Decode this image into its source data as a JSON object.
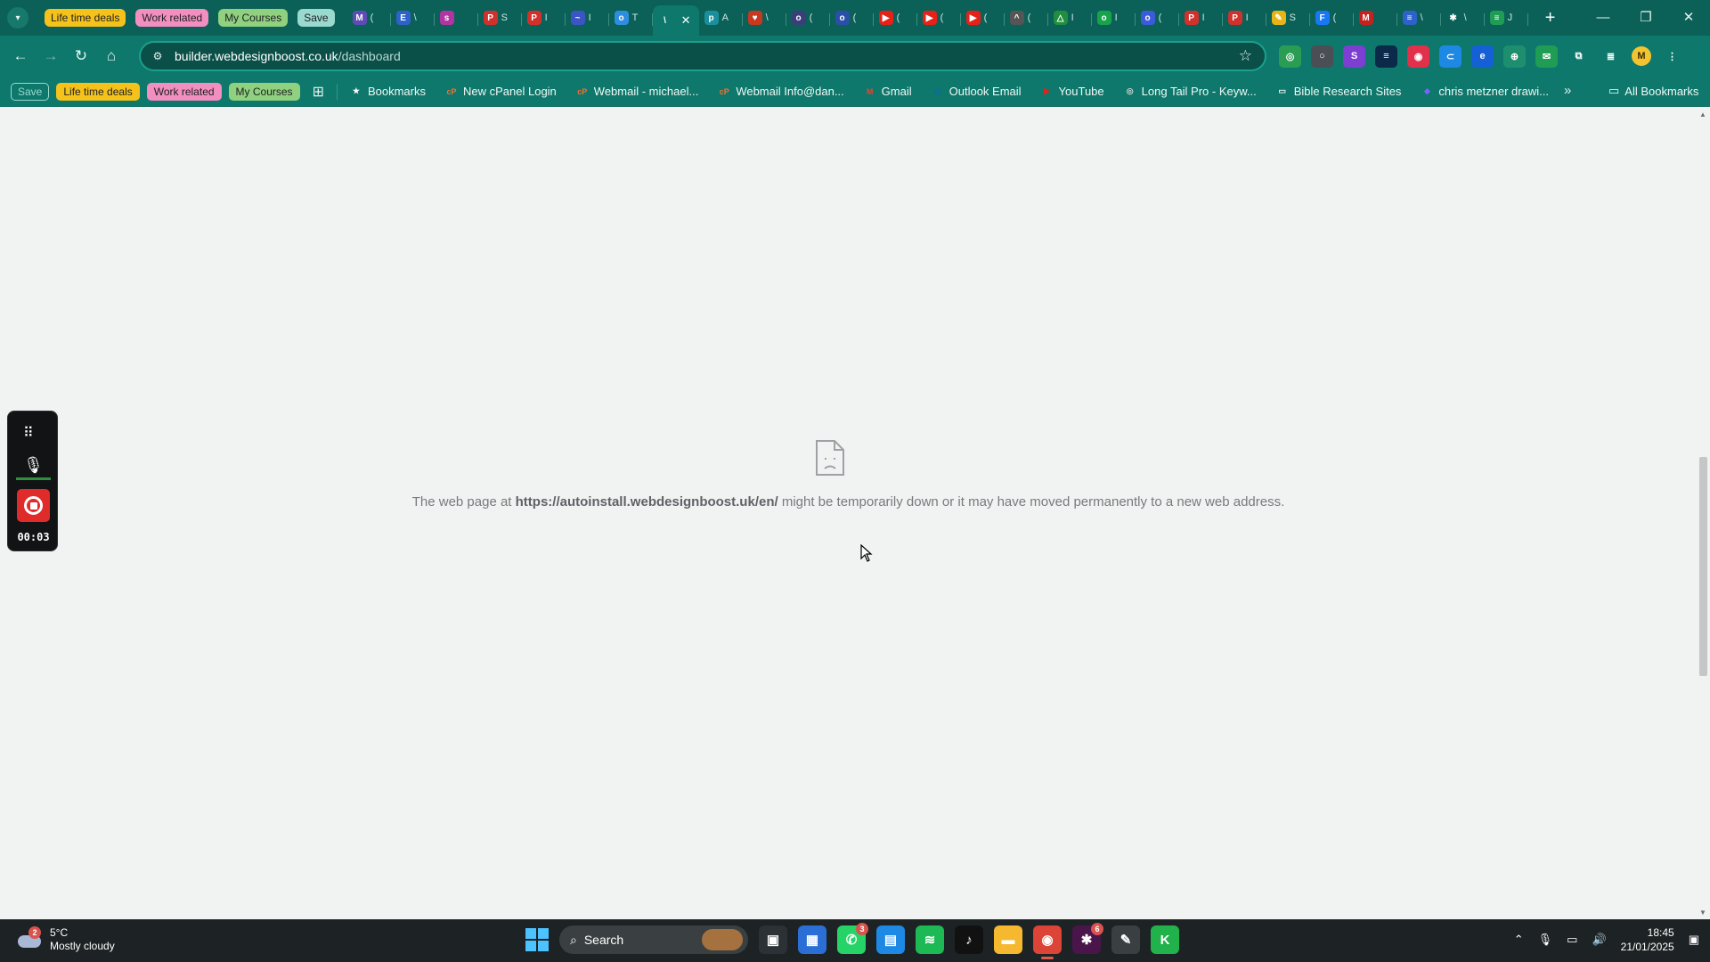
{
  "browser": {
    "tab_groups": [
      {
        "label": "Life time deals",
        "color": "#f4c21b"
      },
      {
        "label": "Work related",
        "color": "#f28fc0"
      },
      {
        "label": "My Courses",
        "color": "#8fd17e"
      },
      {
        "label": "Save",
        "color": "#9ad9ce"
      }
    ],
    "tabs": [
      {
        "icon": "gmail-icon",
        "letter": "M",
        "color": "#5f4bb6",
        "text": "("
      },
      {
        "icon": "doc-icon",
        "letter": "E",
        "color": "#2e62c8",
        "text": "\\"
      },
      {
        "icon": "app-icon",
        "letter": "s",
        "color": "#b234a3",
        "text": ""
      },
      {
        "icon": "pinterest-icon",
        "letter": "P",
        "color": "#d0312d",
        "text": "S"
      },
      {
        "icon": "pinterest-icon",
        "letter": "P",
        "color": "#d0312d",
        "text": "I"
      },
      {
        "icon": "link-icon",
        "letter": "~",
        "color": "#3b55c4",
        "text": "I"
      },
      {
        "icon": "chat-icon",
        "letter": "o",
        "color": "#2f8de0",
        "text": "T"
      },
      {
        "icon": "wix-icon",
        "letter": "\\",
        "color": "#0d786b",
        "text": "",
        "active": true
      },
      {
        "icon": "search-icon",
        "letter": "p",
        "color": "#1b8f9b",
        "text": "A"
      },
      {
        "icon": "heart-icon",
        "letter": "♥",
        "color": "#c8381e",
        "text": "\\"
      },
      {
        "icon": "circle-icon",
        "letter": "o",
        "color": "#3a3f7a",
        "text": "("
      },
      {
        "icon": "circle-icon",
        "letter": "o",
        "color": "#2a4fa8",
        "text": "("
      },
      {
        "icon": "youtube-icon",
        "letter": "▶",
        "color": "#e62117",
        "text": "("
      },
      {
        "icon": "youtube-icon",
        "letter": "▶",
        "color": "#e62117",
        "text": "("
      },
      {
        "icon": "youtube-icon",
        "letter": "▶",
        "color": "#e62117",
        "text": "("
      },
      {
        "icon": "cap-icon",
        "letter": "^",
        "color": "#555",
        "text": "("
      },
      {
        "icon": "drive-icon",
        "letter": "△",
        "color": "#1f8f3f",
        "text": "I"
      },
      {
        "icon": "app-icon",
        "letter": "o",
        "color": "#16a34a",
        "text": "I"
      },
      {
        "icon": "app-icon",
        "letter": "o",
        "color": "#3b5bdb",
        "text": "("
      },
      {
        "icon": "pinterest-icon",
        "letter": "P",
        "color": "#d0312d",
        "text": "I"
      },
      {
        "icon": "pinterest-icon",
        "letter": "P",
        "color": "#d0312d",
        "text": "I"
      },
      {
        "icon": "pencil-icon",
        "letter": "✎",
        "color": "#e7b416",
        "text": "S"
      },
      {
        "icon": "facebook-icon",
        "letter": "F",
        "color": "#1877f2",
        "text": "("
      },
      {
        "icon": "gmail-icon",
        "letter": "M",
        "color": "#c5221f",
        "text": ""
      },
      {
        "icon": "doc-icon",
        "letter": "≡",
        "color": "#2e62c8",
        "text": "\\"
      },
      {
        "icon": "star-icon",
        "letter": "✱",
        "color": "#0b6157",
        "text": "\\"
      },
      {
        "icon": "app-icon",
        "letter": "≡",
        "color": "#1f9d55",
        "text": "J"
      }
    ],
    "address_bar": {
      "host": "builder.webdesignboost.co.uk",
      "path": "/dashboard"
    },
    "bookmark_chips": [
      {
        "label": "Save",
        "color": "#9ad9ce"
      },
      {
        "label": "Life time deals",
        "color": "#f4c21b"
      },
      {
        "label": "Work related",
        "color": "#f28fc0"
      },
      {
        "label": "My Courses",
        "color": "#8fd17e"
      }
    ],
    "bookmarks": [
      {
        "label": "Bookmarks",
        "icon": "star-icon",
        "letter": "★",
        "color": "#ffffff"
      },
      {
        "label": "New cPanel Login",
        "icon": "cpanel-icon",
        "letter": "cP",
        "color": "#ff6c2c"
      },
      {
        "label": "Webmail - michael...",
        "icon": "cpanel-icon",
        "letter": "cP",
        "color": "#ff6c2c"
      },
      {
        "label": "Webmail Info@dan...",
        "icon": "cpanel-icon",
        "letter": "cP",
        "color": "#ff6c2c"
      },
      {
        "label": "Gmail",
        "icon": "gmail-icon",
        "letter": "M",
        "color": "#ea4335"
      },
      {
        "label": "Outlook Email",
        "icon": "outlook-icon",
        "letter": "O",
        "color": "#0a64c8"
      },
      {
        "label": "YouTube",
        "icon": "youtube-icon",
        "letter": "▶",
        "color": "#e62117"
      },
      {
        "label": "Long Tail Pro - Keyw...",
        "icon": "target-icon",
        "letter": "◎",
        "color": "#cfd8d6"
      },
      {
        "label": "Bible Research Sites",
        "icon": "folder-icon",
        "letter": "▭",
        "color": "#f0f9f7"
      },
      {
        "label": "chris metzner drawi...",
        "icon": "drop-icon",
        "letter": "◆",
        "color": "#7b61ff"
      }
    ],
    "all_bookmarks_label": "All Bookmarks"
  },
  "page": {
    "error_prefix": "The web page at",
    "error_url": "https://autoinstall.webdesignboost.uk/en/",
    "error_suffix": "might be temporarily down or it may have moved permanently to a new web address."
  },
  "recorder": {
    "time": "00:03"
  },
  "taskbar": {
    "weather_badge": "2",
    "temperature": "5°C",
    "condition": "Mostly cloudy",
    "search_label": "Search",
    "apps": [
      {
        "icon": "task-view-icon",
        "letter": "▣",
        "color": "#2b3134"
      },
      {
        "icon": "store-icon",
        "letter": "▦",
        "color": "#2b6fd6"
      },
      {
        "icon": "whatsapp-icon",
        "letter": "✆",
        "color": "#25d366",
        "count": "3"
      },
      {
        "icon": "notepad-icon",
        "letter": "▤",
        "color": "#1e88e5"
      },
      {
        "icon": "spotify-icon",
        "letter": "≋",
        "color": "#1db954"
      },
      {
        "icon": "tiktok-icon",
        "letter": "♪",
        "color": "#111111"
      },
      {
        "icon": "file-explorer-icon",
        "letter": "▬",
        "color": "#f5b82e"
      },
      {
        "icon": "chrome-icon",
        "letter": "◉",
        "color": "#db4437",
        "active": true
      },
      {
        "icon": "slack-icon",
        "letter": "✱",
        "color": "#4a154b",
        "count": "6"
      },
      {
        "icon": "pen-tool-icon",
        "letter": "✎",
        "color": "#3a3f41"
      },
      {
        "icon": "k-app-icon",
        "letter": "K",
        "color": "#22b24c"
      }
    ],
    "time": "18:45",
    "date": "21/01/2025"
  }
}
